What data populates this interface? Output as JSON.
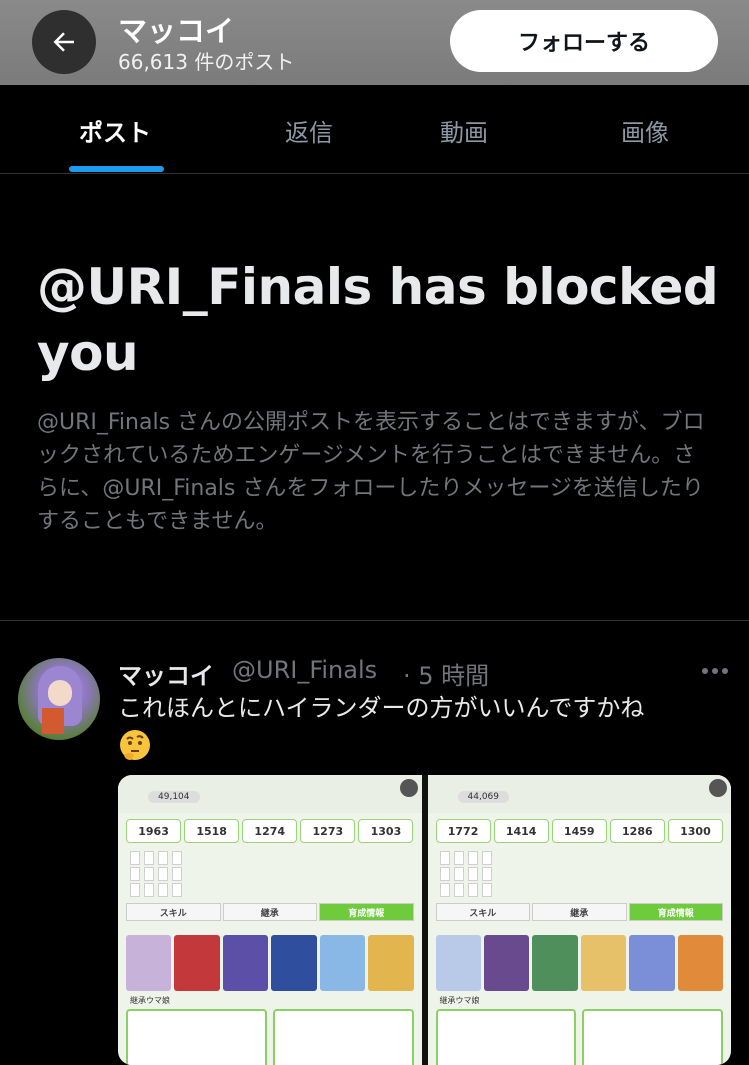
{
  "header": {
    "name": "マッコイ",
    "post_count": "66,613 件のポスト",
    "follow_label": "フォローする"
  },
  "tabs": [
    {
      "label": "ポスト",
      "active": true
    },
    {
      "label": "返信",
      "active": false
    },
    {
      "label": "動画",
      "active": false
    },
    {
      "label": "画像",
      "active": false
    }
  ],
  "blocked": {
    "title": "@URI_Finals has blocked you",
    "description": "@URI_Finals さんの公開ポストを表示することはできますが、ブロックされているためエンゲージメントを行うことはできません。さらに、@URI_Finals さんをフォローしたりメッセージを送信したりすることもできません。"
  },
  "post": {
    "name": "マッコイ",
    "handle": "@URI_Finals",
    "time": "· 5 時間",
    "text": "これほんとにハイランダーの方がいいんですかね",
    "emoji": "thinking-face",
    "images": [
      {
        "count": "49,104",
        "stats": [
          "1963",
          "1518",
          "1274",
          "1273",
          "1303"
        ],
        "tabs": [
          "スキル",
          "継承",
          "育成情報"
        ],
        "section": "継承ウマ娘"
      },
      {
        "count": "44,069",
        "stats": [
          "1772",
          "1414",
          "1459",
          "1286",
          "1300"
        ],
        "tabs": [
          "スキル",
          "継承",
          "育成情報"
        ],
        "section": "継承ウマ娘"
      }
    ]
  },
  "colors": {
    "accent": "#1d9bf0",
    "background": "#000000",
    "muted": "#71767b"
  }
}
